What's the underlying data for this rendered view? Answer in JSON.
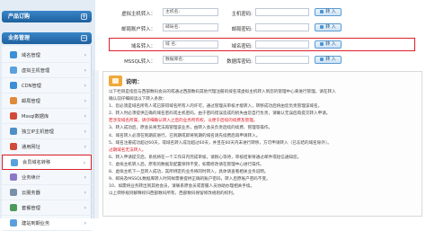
{
  "sidebar": {
    "section1_title": "产品订购",
    "section2_title": "业务管理",
    "items": [
      {
        "label": "域名管理",
        "color": "#3a8fd6"
      },
      {
        "label": "虚拟主机管理",
        "color": "#5aa0dc"
      },
      {
        "label": "CDN管理",
        "color": "#3a8fd6"
      },
      {
        "label": "邮局管理",
        "color": "#e08a3a"
      },
      {
        "label": "Mssql数据库",
        "color": "#d14a3a"
      },
      {
        "label": "独立IP主机管理",
        "color": "#4f8fc8"
      },
      {
        "label": "通用网址",
        "color": "#d14a3a"
      },
      {
        "label": "会员域名转移",
        "color": "#5aa0dc"
      },
      {
        "label": "业务续计",
        "color": "#8a7ac8"
      },
      {
        "label": "云服务器",
        "color": "#7a8fa8"
      },
      {
        "label": "套餐管理",
        "color": "#4a9a5a"
      },
      {
        "label": "建站到期业务",
        "color": "#5aa0dc"
      }
    ]
  },
  "form": {
    "rows": [
      {
        "label": "虚拟主机转入：",
        "input1": "主机名:",
        "mid_label": "主机密码:",
        "button": "转 入"
      },
      {
        "label": "邮局账户转入：",
        "input1": "邮局名:",
        "mid_label": "邮局密码:",
        "button": "转 入"
      },
      {
        "label": "域名转入：",
        "input1": "域 名:",
        "mid_label": "域名密码:",
        "button": "转 入"
      },
      {
        "label": "MSSQL转入：",
        "input1": "数据库名:",
        "mid_label": "数据库密码:",
        "button": "转 入"
      }
    ]
  },
  "notice": {
    "title": "说明：",
    "lines": [
      {
        "text": "以下栏目是指您与西部数码会员的或通过西部数码其他代理注册的域名或虚拟主机转入到您的管理中心来进行管理。请在转入",
        "red": false
      },
      {
        "text": "确认前仔细阅读以下转入条款：",
        "red": false
      },
      {
        "text": "1、您必须是域名所有人或已获得域名所有人的许可，通过管理员审核才能转入，转移成功后将由您负责管理该域名。",
        "red": false
      },
      {
        "text": "2、转入时必须提供正确的域名密码或主机密码，由于密码错误造成的损失由您自行负责，请确认无误后再提交转入申请。",
        "red": false
      },
      {
        "text": "    若涉及域名所属，请仔细确认转入之后的业务所有权，以便于后续的续费及管理。",
        "red": true
      },
      {
        "text": "3、转入成功后，原会员将无法再管理该业务，由转入会员负责后续的续费、管理等操作。",
        "red": false
      },
      {
        "text": "4、域名转入必须在到期前进行，已到期或即将到期的域名请先续费后再申请转入。",
        "red": false
      },
      {
        "text": "5、域名注册成功超过60天，或域名转入成功超过60天，并且在60天内未进行转移，方可申请转入（已冻结的域名除外）。",
        "red": false
      },
      {
        "text": "    过期域名无法转入。",
        "red": true
      },
      {
        "text": "6、转入申请提交后，系统将在一个工作日内完成审核，请耐心等待，审核结果将通过邮件或短信通知您。",
        "red": false
      },
      {
        "text": "7、虚拟主机转入后，原有的数据及配置保持不变，如需修改请在管理中心进行操作。",
        "red": false
      },
      {
        "text": "8、虚拟主机下一旦转入成功，其所绑定的业务将同时转入，具体请查看相关业务说明。",
        "red": false
      },
      {
        "text": "9、邮局及MSSQL数据库转入时同样需要提供正确的账户密码，转入后原账户密码不变。",
        "red": false
      },
      {
        "text": "10、如需将业务转出到其他会员，请联系原会员或客服人员协助办理相关手续。",
        "red": false
      },
      {
        "text": "以上转移规则解释权归西部数码所有，西部数码保留修改规则的权利。",
        "red": false
      }
    ]
  }
}
